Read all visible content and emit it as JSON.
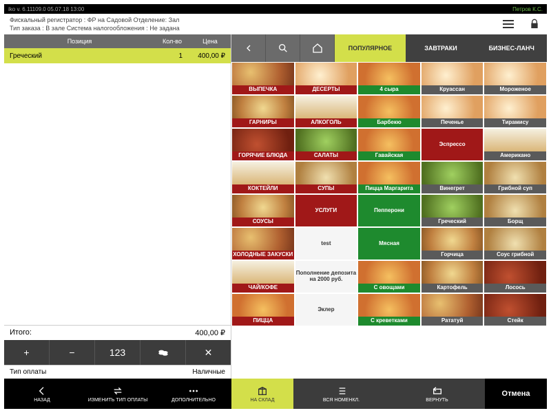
{
  "topbar": {
    "version": "iko v. 6.11109.0   05.07.18   13:00",
    "user": "Петров К.С."
  },
  "info": {
    "line1": "Фискальный регистратор :   ФР на Садовой     Отделение: Зал",
    "line2": "Тип заказа :  В зале     Система налогообложения :  Не задана"
  },
  "order": {
    "headers": {
      "pos": "Позиция",
      "qty": "Кол-во",
      "price": "Цена"
    },
    "rows": [
      {
        "name": "Греческий",
        "qty": "1",
        "price": "400,00 ₽"
      }
    ],
    "total_label": "Итого:",
    "total_value": "400,00 ₽",
    "numpad": {
      "plus": "+",
      "minus": "−",
      "n123": "123",
      "x": "✕"
    },
    "paytype_label": "Тип оплаты",
    "paytype_value": "Наличные"
  },
  "tabs": {
    "popular": "ПОПУЛЯРНОЕ",
    "breakfast": "ЗАВТРАКИ",
    "lunch": "БИЗНЕС-ЛАНЧ"
  },
  "categories": [
    {
      "n": "ВЫПЕЧКА"
    },
    {
      "n": "ДЕСЕРТЫ"
    },
    {
      "n": "ГАРНИРЫ"
    },
    {
      "n": "АЛКОГОЛЬ"
    },
    {
      "n": "ГОРЯЧИЕ БЛЮДА"
    },
    {
      "n": "САЛАТЫ"
    },
    {
      "n": "КОКТЕЙЛИ"
    },
    {
      "n": "СУПЫ"
    },
    {
      "n": "СОУСЫ"
    },
    {
      "n": "УСЛУГИ",
      "solid": true
    },
    {
      "n": "ХОЛОДНЫЕ ЗАКУСКИ"
    },
    {
      "n": "test",
      "white": true
    },
    {
      "n": "ЧАЙ/КОФЕ"
    },
    {
      "n": "Пополнение депозита на 2000 руб.",
      "white": true
    },
    {
      "n": "ПИЦЦА"
    },
    {
      "n": "Эклер",
      "white": true
    }
  ],
  "products": [
    {
      "n": "4 сыра",
      "g": true
    },
    {
      "n": "Круассан"
    },
    {
      "n": "Мороженое"
    },
    {
      "n": "Барбекю",
      "g": true
    },
    {
      "n": "Печенье"
    },
    {
      "n": "Тирамису"
    },
    {
      "n": "Гавайская",
      "g": true
    },
    {
      "n": "Эспрессо",
      "sr": true
    },
    {
      "n": "Американо"
    },
    {
      "n": "Пицца Маргарита",
      "g": true
    },
    {
      "n": "Винегрет"
    },
    {
      "n": "Грибной суп"
    },
    {
      "n": "Пепперони",
      "sg": true
    },
    {
      "n": "Греческий"
    },
    {
      "n": "Борщ"
    },
    {
      "n": "Мясная",
      "sg": true
    },
    {
      "n": "Горчица"
    },
    {
      "n": "Соус грибной"
    },
    {
      "n": "С овощами",
      "g": true
    },
    {
      "n": "Картофель"
    },
    {
      "n": "Лосось"
    },
    {
      "n": "С креветками",
      "g": true
    },
    {
      "n": "Рататуй"
    },
    {
      "n": "Стейк"
    }
  ],
  "bottom": {
    "back": "НАЗАД",
    "change_pay": "ИЗМЕНИТЬ ТИП ОПЛАТЫ",
    "more": "ДОПОЛНИТЕЛЬНО",
    "to_stock": "НА СКЛАД",
    "all_nom": "ВСЯ НОМЕНКЛ.",
    "return": "ВЕРНУТЬ",
    "cancel": "Отмена"
  }
}
